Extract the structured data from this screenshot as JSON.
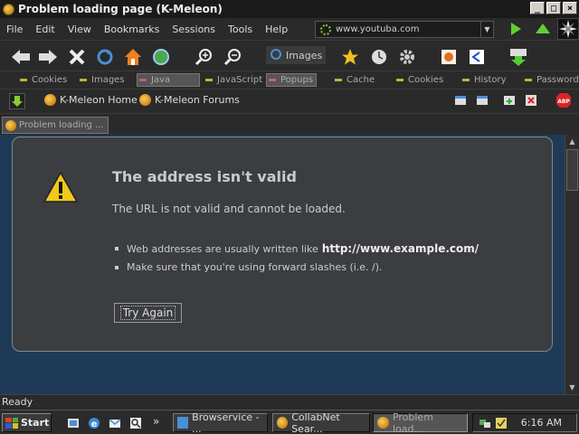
{
  "window": {
    "title": "Problem loading page (K-Meleon)",
    "min": "_",
    "max": "□",
    "close": "×"
  },
  "menu": [
    "File",
    "Edit",
    "View",
    "Bookmarks",
    "Sessions",
    "Tools",
    "Help"
  ],
  "url": {
    "value": "www.youtuba.com",
    "dropdown": "▼"
  },
  "toolbar": {
    "images_label": "Images"
  },
  "toggles": [
    {
      "label": "Cookies",
      "active": false
    },
    {
      "label": "Images",
      "active": false
    },
    {
      "label": "Java",
      "active": true
    },
    {
      "label": "JavaScript",
      "active": false
    },
    {
      "label": "Popups",
      "active": true
    },
    {
      "label": "Cache",
      "active": false
    },
    {
      "label": "Cookies",
      "active": false
    },
    {
      "label": "History",
      "active": false
    },
    {
      "label": "Passwords",
      "active": false
    }
  ],
  "bookmarks": [
    "K-Meleon Home",
    "K-Meleon Forums"
  ],
  "tab": {
    "label": "Problem loading ..."
  },
  "error": {
    "title": "The address isn't valid",
    "message": "The URL is not valid and cannot be loaded.",
    "bullet1_text": "Web addresses are usually written like",
    "bullet1_example": "http://www.example.com/",
    "bullet2_text": "Make sure that you're using forward slashes (i.e. /).",
    "button": "Try Again"
  },
  "scroll": {
    "up": "▲",
    "down": "▼"
  },
  "status": {
    "text": "Ready"
  },
  "taskbar": {
    "start": "Start",
    "more": "»",
    "tasks": [
      {
        "label": "Browservice - ...",
        "active": false
      },
      {
        "label": "CollabNet Sear...",
        "active": false
      },
      {
        "label": "Problem load...",
        "active": true
      }
    ],
    "clock": "6:16 AM"
  },
  "colors": {
    "accent_green": "#66cc33",
    "content_bg": "#1e3a57",
    "panel_bg": "#3b3d40"
  }
}
